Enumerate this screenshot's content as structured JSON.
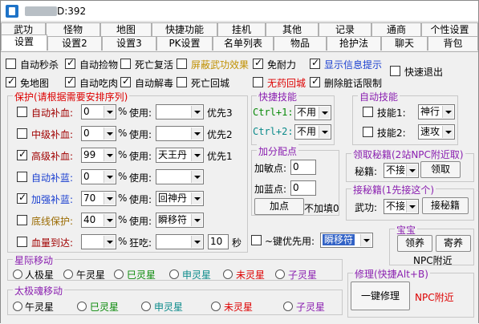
{
  "window": {
    "title": "D:392"
  },
  "tabs_row1": [
    "武功",
    "怪物",
    "地图",
    "快捷功能",
    "挂机",
    "其他",
    "记录",
    "通商",
    "个性设置"
  ],
  "tabs_row2": [
    "设置",
    "设置2",
    "设置3",
    "PK设置",
    "名单列表",
    "物品",
    "抢护法",
    "聊天",
    "背包"
  ],
  "top_options": {
    "auto_kill": "自动秒杀",
    "auto_pick": "自动捡物",
    "die_revive": "死亡复活",
    "block_martial": "屏蔽武功效果",
    "no_stamina": "免耐力",
    "show_info": "显示信息提示",
    "quick_exit": "快速退出",
    "no_map": "免地图",
    "auto_eat": "自动吃肉",
    "auto_detox": "自动解毒",
    "die_return": "死亡回城",
    "no_med_return": "无药回城",
    "del_dirty": "删除脏话限制"
  },
  "protect": {
    "title": "保护(请根据需要安排序列)",
    "use_label": "使用:",
    "pct": "%",
    "rows": [
      {
        "label": "自动补血:",
        "value": "0",
        "item": "",
        "prio": "优先3",
        "checked": false
      },
      {
        "label": "中级补血:",
        "value": "0",
        "item": "",
        "prio": "优先2",
        "checked": false
      },
      {
        "label": "高级补血:",
        "value": "99",
        "item": "天王丹",
        "prio": "优先1",
        "checked": true
      },
      {
        "label": "自动补蓝:",
        "value": "0",
        "item": "",
        "prio": "",
        "checked": false
      },
      {
        "label": "加强补蓝:",
        "value": "70",
        "item": "回神丹",
        "prio": "",
        "checked": true
      },
      {
        "label": "底线保护:",
        "value": "40",
        "item": "瞬移符",
        "prio": "",
        "checked": false
      },
      {
        "label": "血量到达:",
        "value": "",
        "item": "",
        "prio": "",
        "checked": false
      }
    ],
    "crazy_label": "狂吃:",
    "crazy_value": "10",
    "sec": "秒"
  },
  "quick_skill": {
    "title": "快捷技能",
    "k1": "Ctrl+1:",
    "k1_val": "不用",
    "k2": "Ctrl+2:",
    "k2_val": "不用"
  },
  "auto_skill": {
    "title": "自动技能",
    "s1": "技能1:",
    "s1_val": "神行",
    "s2": "技能2:",
    "s2_val": "速攻"
  },
  "points": {
    "title": "加分配点",
    "add": "加敏点:",
    "add_val": "0",
    "blue": "加蓝点:",
    "blue_val": "0",
    "btn": "加点",
    "note": "不加填0"
  },
  "secret_book": {
    "title": "领取秘籍(2站NPC附近取)",
    "label": "秘籍:",
    "val": "不接",
    "btn": "领取"
  },
  "accept_book": {
    "title": "接秘籍(1先接这个)",
    "label": "武功:",
    "val": "不接",
    "btn": "接秘籍"
  },
  "hotkey": {
    "label": "~键优先用:",
    "val": "瞬移符"
  },
  "treasure": {
    "title": "宝宝",
    "b1": "领养",
    "b2": "寄养",
    "note": "NPC附近"
  },
  "star_move": {
    "title": "星际移动",
    "items": [
      "人极星",
      "午灵星",
      "巳灵星",
      "申灵星",
      "未灵星",
      "子灵星"
    ]
  },
  "taiji_move": {
    "title": "太极魂移动",
    "items": [
      "午灵星",
      "巳灵星",
      "申灵星",
      "未灵星",
      "子灵星"
    ]
  },
  "repair": {
    "title": "修理(快捷Alt+B)",
    "btn": "一键修理",
    "note": "NPC附近"
  }
}
